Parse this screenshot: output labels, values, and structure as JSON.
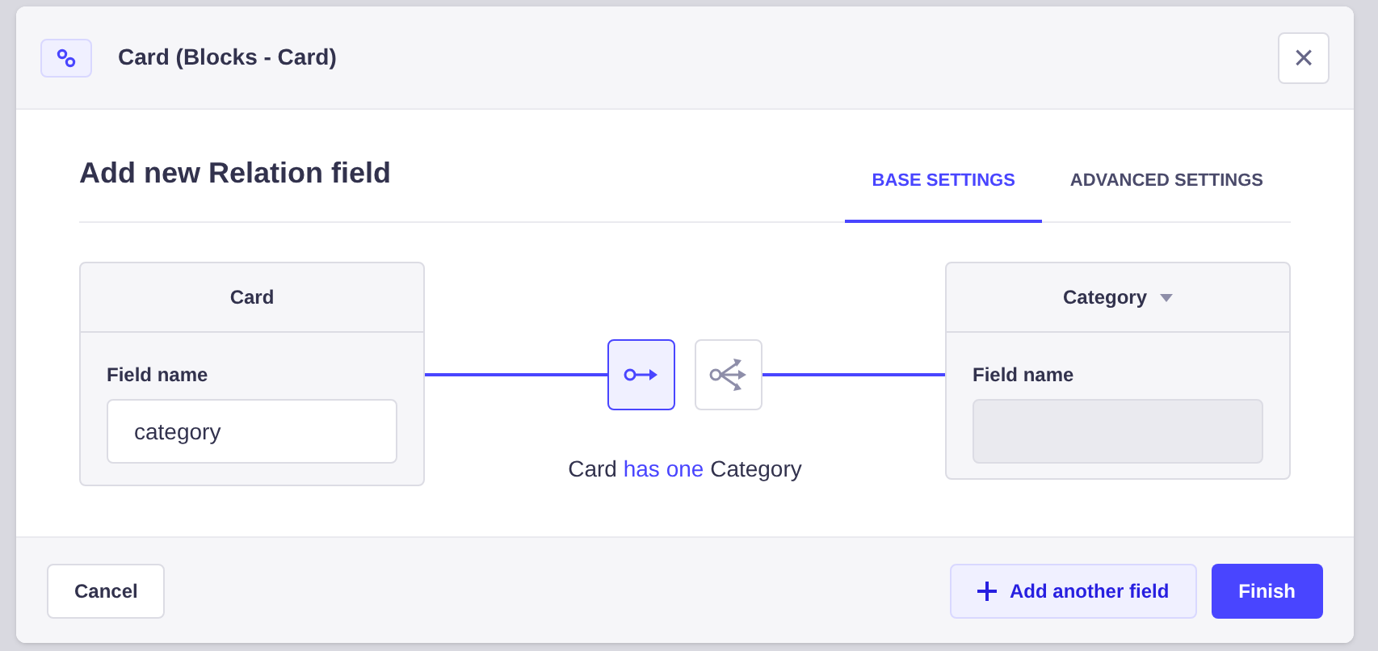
{
  "header": {
    "title": "Card (Blocks - Card)"
  },
  "close_button": {
    "label": "×"
  },
  "form": {
    "title": "Add new Relation field"
  },
  "tabs": [
    {
      "label": "BASE SETTINGS",
      "selected": true
    },
    {
      "label": "ADVANCED SETTINGS",
      "selected": false
    }
  ],
  "left_card": {
    "title": "Card",
    "field_label": "Field name",
    "value": "category"
  },
  "relation_types": [
    {
      "kind": "one-way",
      "selected": true
    },
    {
      "kind": "many-way",
      "selected": false
    }
  ],
  "relation_sentence": {
    "left": "Card",
    "relation": "has one",
    "right": "Category"
  },
  "right_card": {
    "title": "Category",
    "field_label": "Field name",
    "disabled": true
  },
  "footer": {
    "cancel": "Cancel",
    "add_another": "Add another field",
    "finish": "Finish"
  }
}
